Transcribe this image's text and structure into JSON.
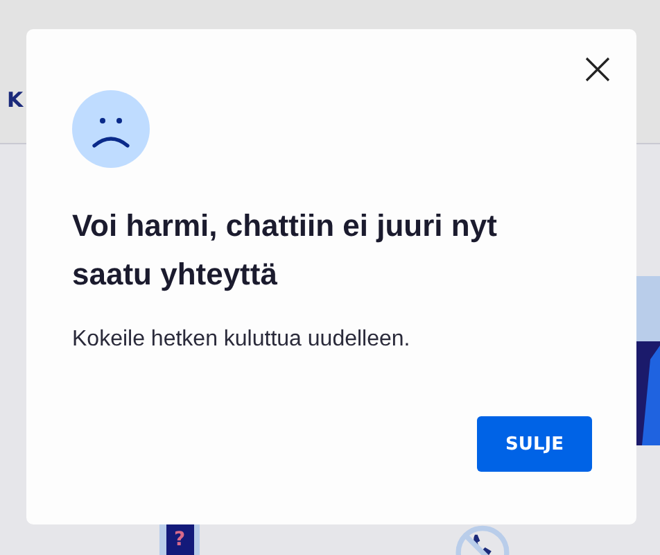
{
  "background": {
    "header_text": "K",
    "help_icon_text": "?"
  },
  "dialog": {
    "title": "Voi harmi, chattiin ei juuri nyt saatu yhteyttä",
    "message": "Kokeile hetken kuluttua uudelleen.",
    "buttons": [
      "SULJE"
    ]
  }
}
